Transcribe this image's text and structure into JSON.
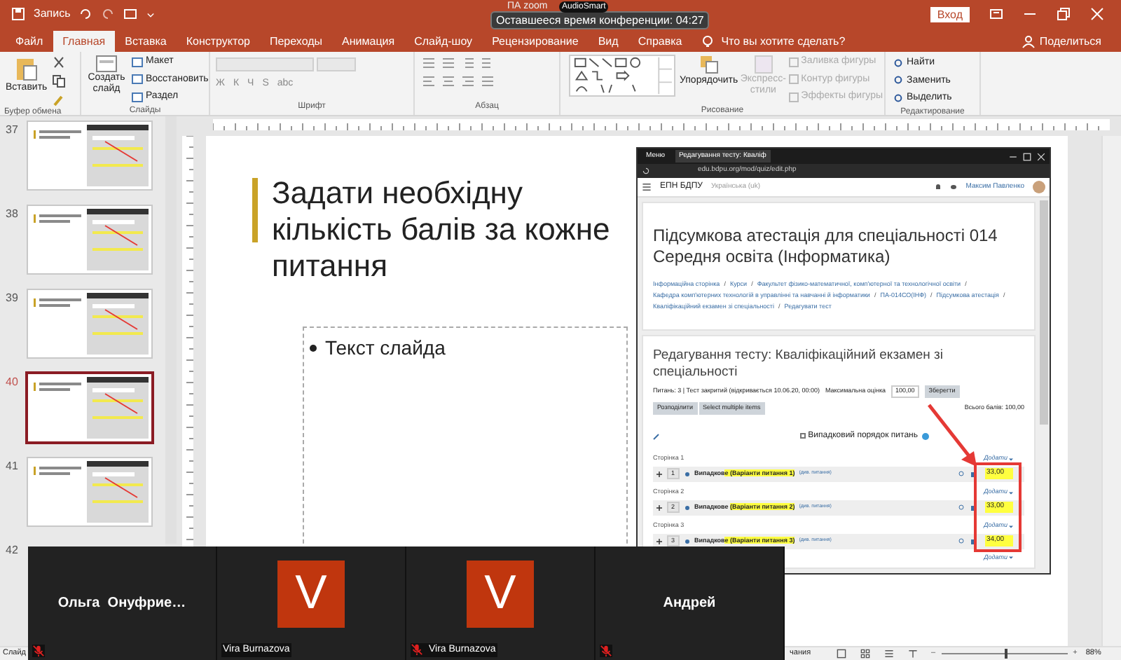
{
  "titlebar": {
    "record_label": "Запись",
    "meeting_title": "ПА zoom",
    "timer": "Оставшееся время конференции: 04:27",
    "audio_label": "AudioSmart",
    "signin_button": "Вход"
  },
  "ribbon_tabs": [
    {
      "label": "Файл",
      "selected": false
    },
    {
      "label": "Главная",
      "selected": true
    },
    {
      "label": "Вставка",
      "selected": false
    },
    {
      "label": "Конструктор",
      "selected": false
    },
    {
      "label": "Переходы",
      "selected": false
    },
    {
      "label": "Анимация",
      "selected": false
    },
    {
      "label": "Слайд-шоу",
      "selected": false
    },
    {
      "label": "Рецензирование",
      "selected": false
    },
    {
      "label": "Вид",
      "selected": false
    },
    {
      "label": "Справка",
      "selected": false
    }
  ],
  "tell_me": "Что вы хотите сделать?",
  "share": "Поделиться",
  "ribbon": {
    "clipboard": {
      "group": "Буфер обмена",
      "paste": "Вставить"
    },
    "slides": {
      "group": "Слайды",
      "new_slide": "Создать слайд",
      "layout": "Макет",
      "reset": "Восстановить",
      "section": "Раздел"
    },
    "font": {
      "group": "Шрифт",
      "buttons": [
        "Ж",
        "К",
        "Ч",
        "S",
        "abc"
      ]
    },
    "paragraph": {
      "group": "Абзац"
    },
    "drawing": {
      "group": "Рисование",
      "arrange": "Упорядочить",
      "quick_styles": {
        "label": "Экспресс-стили",
        "disabled": true
      },
      "shape_tools": [
        {
          "label": "Заливка фигуры",
          "disabled": true
        },
        {
          "label": "Контур фигуры",
          "disabled": true
        },
        {
          "label": "Эффекты фигуры",
          "disabled": true
        }
      ]
    },
    "editing": {
      "group": "Редактирование",
      "find": "Найти",
      "replace": "Заменить",
      "select": "Выделить"
    }
  },
  "slides_panel": [
    {
      "number": "37",
      "selected": false,
      "kind": "thumbnail"
    },
    {
      "number": "38",
      "selected": false,
      "kind": "thumbnail"
    },
    {
      "number": "39",
      "selected": false,
      "kind": "thumbnail"
    },
    {
      "number": "40",
      "selected": true,
      "kind": "thumbnail"
    },
    {
      "number": "41",
      "selected": false,
      "kind": "thumbnail"
    },
    {
      "number": "42",
      "selected": false,
      "kind": "number_only"
    }
  ],
  "slide": {
    "title": "Задати необхідну кількість балів за кожне питання",
    "bullet": "Текст слайда",
    "browser": {
      "tabs": [
        {
          "label": "Меню",
          "selected": false
        },
        {
          "label": "Редагування тесту: Кваліф",
          "selected": true
        }
      ],
      "url": "edu.bdpu.org/mod/quiz/edit.php",
      "site": "ЕПН БДПУ",
      "language": "Українська (uk)",
      "user": "Максим Павленко",
      "breadcrumb_separator": "/",
      "heading": "Підсумкова атестація для спеціальності 014 Середня освіта (Інформатика)",
      "breadcrumbs": [
        "Інформаційна сторінка",
        "Курси",
        "Факультет фізико-математичної, комп'ютерної та технологічної освіти",
        "Кафедра комп'ютерних технологій в управлінні та навчанні й інформатики",
        "ПА-014СО(ІНФ)",
        "Підсумкова атестація",
        "Кваліфікаційний екзамен зі спеціальності",
        "Редагувати тест"
      ],
      "section_title": "Редагування тесту: Кваліфікаційний екзамен зі спеціальності",
      "info": "Питань: 3 | Тест закритий (відкривається 10.06.20, 00:00)",
      "max_grade_label": "Максимальна оцінка",
      "max_grade": "100,00",
      "save": "Зберегти",
      "actions": [
        "Розподілити",
        "Select multiple items"
      ],
      "total": "Всього балів: 100,00",
      "shuffle": {
        "label": "Випадковий порядок питань",
        "checked": false
      },
      "pages": [
        {
          "title": "Сторінка 1",
          "add": "Додати",
          "number": "1",
          "plain": "Випадков",
          "highlight": "е (Варіанти питання 1)",
          "link": "(див. питання)",
          "mark": "33,00"
        },
        {
          "title": "Сторінка 2",
          "add": "Додати",
          "number": "2",
          "plain": "Випадкове ",
          "highlight": "(Варіанти питання 2)",
          "link": "(див. питання)",
          "mark": "33,00"
        },
        {
          "title": "Сторінка 3",
          "add": "Додати",
          "number": "3",
          "plain": "Випадков",
          "highlight": "е (Варіанти питання 3)",
          "link": "(див. питання)",
          "mark": "34,00"
        }
      ],
      "final_add": "Додати"
    }
  },
  "zoom": {
    "tiles": [
      {
        "kind": "name",
        "name": "Ольга  Онуфрие…",
        "muted": true
      },
      {
        "kind": "avatar",
        "letter": "V",
        "name": "Vira Burnazova",
        "muted": false
      },
      {
        "kind": "avatar",
        "letter": "V",
        "name": "Vira Burnazova",
        "muted": true
      },
      {
        "kind": "name",
        "name": "Андрей",
        "muted": true
      }
    ]
  },
  "status_bar": {
    "slide": "Слайд",
    "notes": "чания",
    "zoom_out": "–",
    "zoom_in": "+",
    "zoom": "88%",
    "level": 0.5
  }
}
